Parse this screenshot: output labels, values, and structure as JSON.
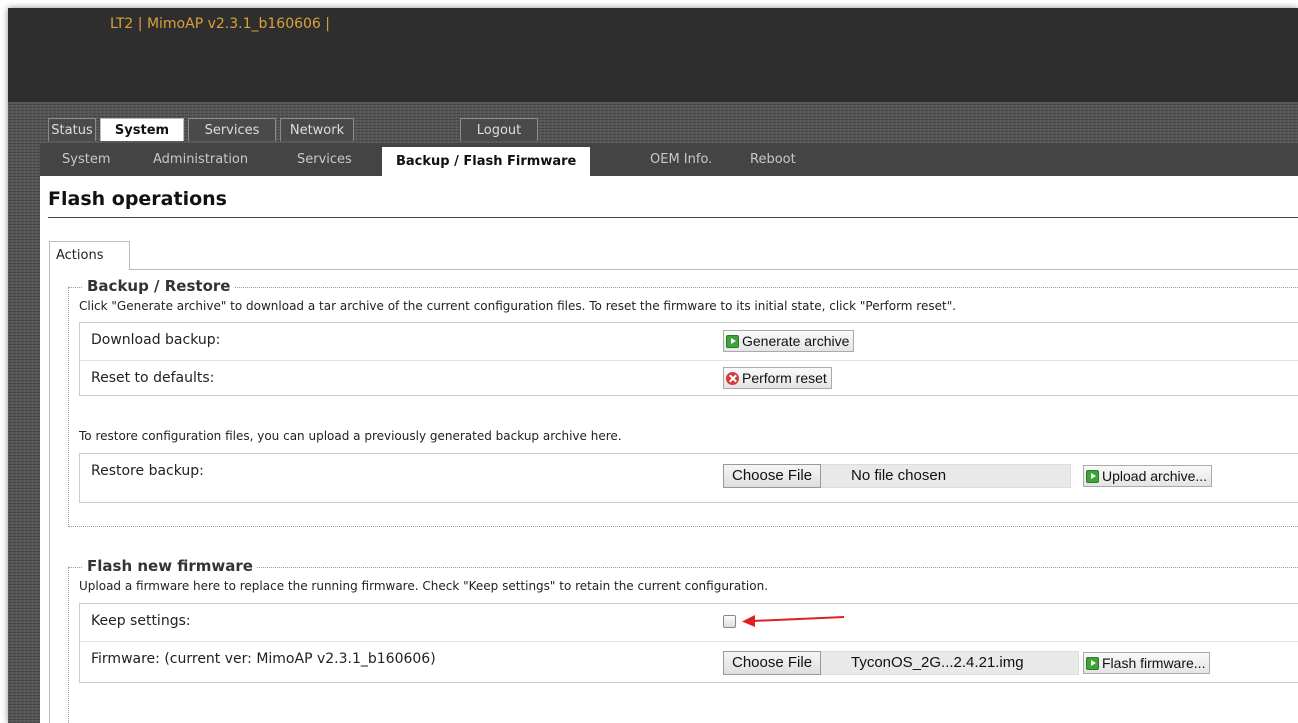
{
  "header": {
    "brand_text": "LT2 | MimoAP v2.3.1_b160606 |"
  },
  "main_tabs": [
    {
      "label": "Status"
    },
    {
      "label": "System"
    },
    {
      "label": "Services"
    },
    {
      "label": "Network"
    },
    {
      "label": "Logout"
    }
  ],
  "sub_tabs": [
    {
      "label": "System"
    },
    {
      "label": "Administration"
    },
    {
      "label": "Services"
    },
    {
      "label": "Backup / Flash Firmware"
    },
    {
      "label": "OEM Info."
    },
    {
      "label": "Reboot"
    }
  ],
  "active_main_tab": "System",
  "active_sub_tab": "Backup / Flash Firmware",
  "page": {
    "title": "Flash operations",
    "section_tab": "Actions",
    "backup": {
      "legend": "Backup / Restore",
      "description": "Click \"Generate archive\" to download a tar archive of the current configuration files. To reset the firmware to its initial state, click \"Perform reset\".",
      "download_label": "Download backup:",
      "generate_button": "Generate archive",
      "reset_label": "Reset to defaults:",
      "reset_button": "Perform reset",
      "restore_description": "To restore configuration files, you can upload a previously generated backup archive here.",
      "restore_label": "Restore backup:",
      "choose_file_button": "Choose File",
      "file_status": "No file chosen",
      "upload_button": "Upload archive..."
    },
    "flash": {
      "legend": "Flash new firmware",
      "description": "Upload a firmware here to replace the running firmware. Check \"Keep settings\" to retain the current configuration.",
      "keep_label": "Keep settings:",
      "keep_checked": false,
      "firmware_label": "Firmware: (current ver: MimoAP v2.3.1_b160606)",
      "choose_file_button": "Choose File",
      "file_name": "TyconOS_2G...2.4.21.img",
      "flash_button": "Flash firmware..."
    }
  },
  "colors": {
    "brand_text": "#d9a13a",
    "header_bg": "#2e2e2e",
    "annotation_arrow": "#e02020",
    "action_icon_green": "#3fa33a",
    "action_icon_red": "#d63b3b"
  },
  "icons": {
    "generate": "green-play-icon",
    "reset": "red-x-icon",
    "upload": "green-play-icon",
    "flash": "green-play-icon",
    "annotation": "red-arrow-icon"
  }
}
